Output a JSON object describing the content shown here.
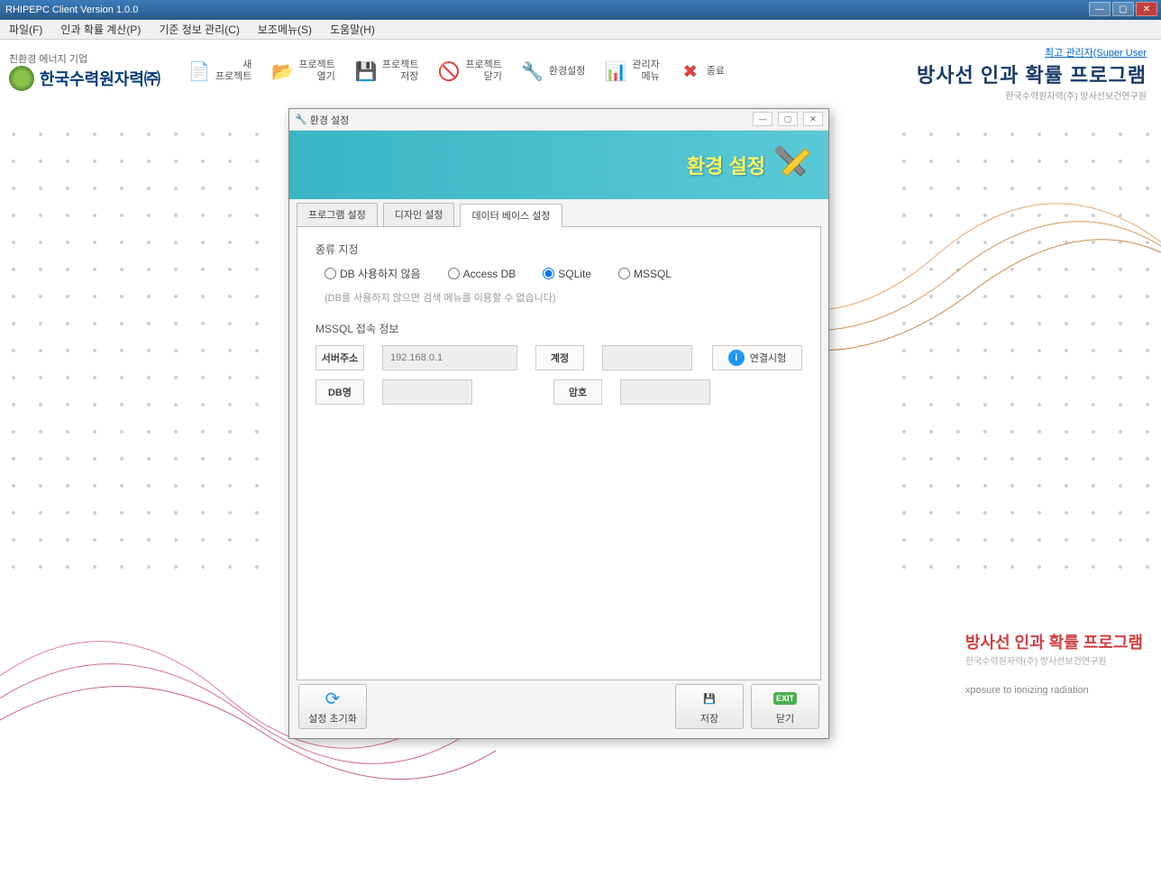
{
  "window": {
    "title": "RHIPEPC Client Version 1.0.0"
  },
  "menu": {
    "file": "파일(F)",
    "calc": "인과 확률 계산(P)",
    "base": "기준 정보 관리(C)",
    "aux": "보조메뉴(S)",
    "help": "도움말(H)"
  },
  "company": {
    "tag": "친환경 에너지 기업",
    "name": "한국수력원자력㈜"
  },
  "toolbar": {
    "new_project": "새\n프로젝트",
    "open_project": "프로젝트\n열기",
    "save_project": "프로젝트\n저장",
    "close_project": "프로젝트\n닫기",
    "env_settings": "환경설정",
    "admin_menu": "관리자\n메뉴",
    "exit": "종료"
  },
  "header": {
    "super_user": "최고 관리자(Super User",
    "program_title": "방사선 인과 확률 프로그램",
    "program_sub": "한국수력원자력(주) 방사선보건연구원"
  },
  "dialog": {
    "title": "환경 설정",
    "banner": "환경 설정",
    "tabs": {
      "program": "프로그램 설정",
      "design": "디자인 설정",
      "database": "데이터 베이스 설정"
    },
    "section_type": "종류 지정",
    "radios": {
      "none": "DB 사용하지 않음",
      "access": "Access DB",
      "sqlite": "SQLite",
      "mssql": "MSSQL"
    },
    "hint": "(DB를 사용하지 않으면 검색 메뉴를 이용할 수 없습니다)",
    "section_mssql": "MSSQL 접속 정보",
    "labels": {
      "server": "서버주소",
      "dbname": "DB명",
      "account": "계정",
      "password": "암호"
    },
    "server_value": "192.168.0.1",
    "test_conn": "연결시험",
    "footer": {
      "reset": "설정 초기화",
      "save": "저장",
      "close": "닫기"
    }
  },
  "brand": {
    "title": "방사선 인과 확률 프로그램",
    "sub": "한국수력원자력(주) 방사선보건연구원",
    "en": "xposure to ionizing radiation"
  }
}
